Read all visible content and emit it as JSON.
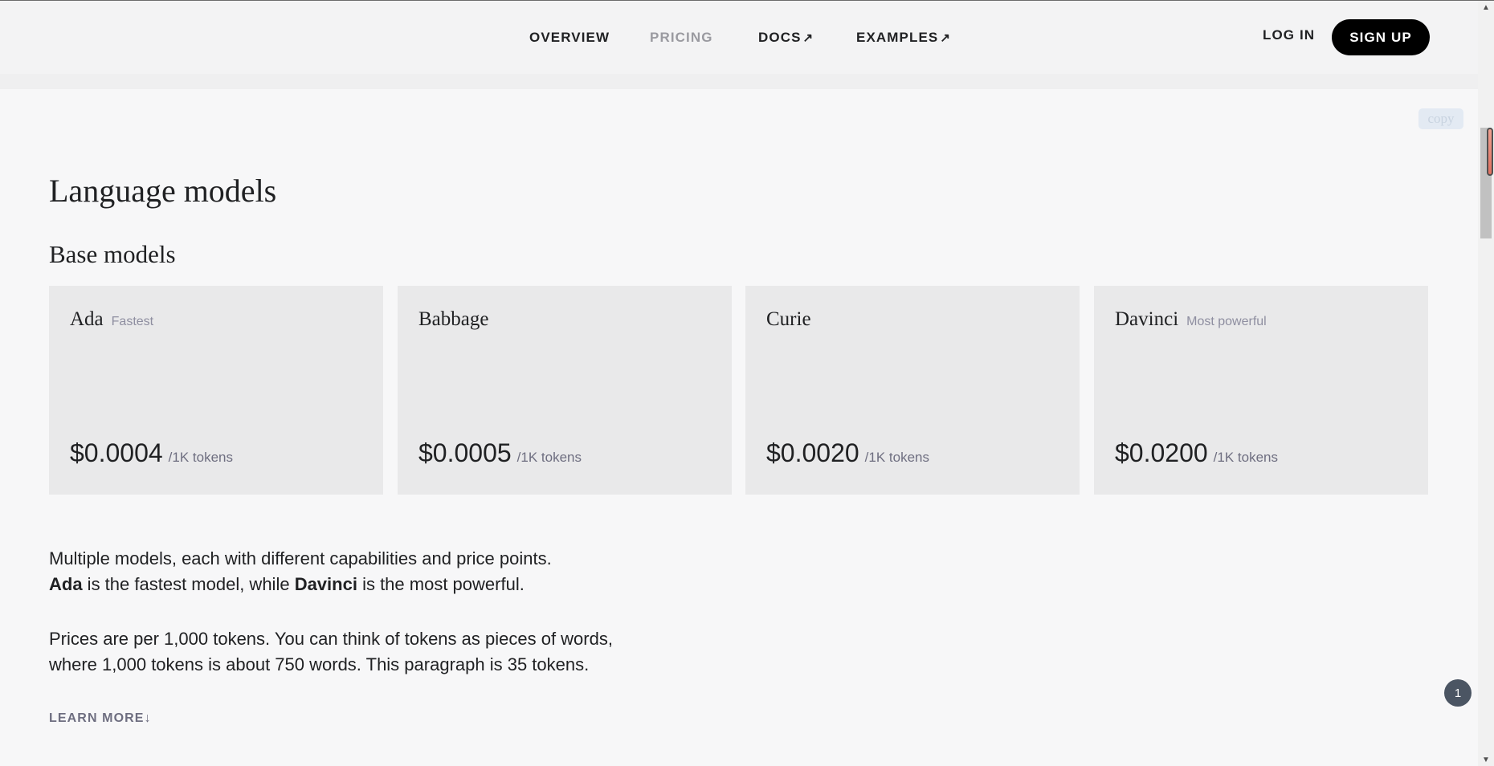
{
  "nav": {
    "overview": "OVERVIEW",
    "pricing": "PRICING",
    "docs": "DOCS",
    "examples": "EXAMPLES",
    "external_arrow": "↗",
    "login": "LOG IN",
    "signup": "SIGN UP"
  },
  "copy_label": "copy",
  "section_title": "Language models",
  "subsection_title": "Base models",
  "cards": [
    {
      "name": "Ada",
      "tag": "Fastest",
      "price": "$0.0004",
      "unit": "/1K tokens"
    },
    {
      "name": "Babbage",
      "tag": "",
      "price": "$0.0005",
      "unit": "/1K tokens"
    },
    {
      "name": "Curie",
      "tag": "",
      "price": "$0.0020",
      "unit": "/1K tokens"
    },
    {
      "name": "Davinci",
      "tag": "Most powerful",
      "price": "$0.0200",
      "unit": "/1K tokens"
    }
  ],
  "paragraph1": {
    "line1": "Multiple models, each with different capabilities and price points.",
    "bold1": "Ada",
    "mid": " is the fastest model, while ",
    "bold2": "Davinci",
    "end": " is the most powerful."
  },
  "paragraph2": {
    "line1": "Prices are per 1,000 tokens. You can think of tokens as pieces of words,",
    "line2": "where 1,000 tokens is about 750 words. This paragraph is 35 tokens."
  },
  "learn_more": "LEARN MORE",
  "learn_more_arrow": "↓",
  "notification_count": "1",
  "colors": {
    "background": "#f7f7f8",
    "card": "#e9e9ea",
    "signup_bg": "#000000",
    "muted": "#8e8ea0",
    "badge": "#4b5563"
  }
}
